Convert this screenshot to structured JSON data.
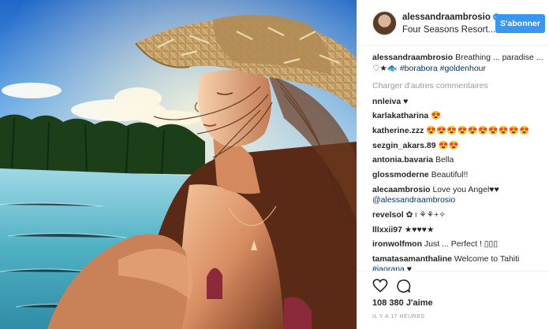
{
  "post": {
    "header": {
      "username": "alessandraambrosio",
      "location": "Four Seasons Resort...",
      "follow_label": "S'abonner"
    },
    "caption": {
      "username": "alessandraambrosio",
      "text": "Breathing ... paradise ... ♡★🐟 ",
      "tag1": "#borabora",
      "tag2": "#goldenhour"
    },
    "load_more_label": "Charger d'autres commentaires",
    "comments": [
      {
        "user": "nnleiva",
        "text": "♥"
      },
      {
        "user": "karlakatharina",
        "text": "😍"
      },
      {
        "user": "katherine.zzz",
        "text": "😍😍😍😍😍😍😍😍😍😍"
      },
      {
        "user": "sezgin_akars.89",
        "text": "😍😍"
      },
      {
        "user": "antonia.bavaria",
        "text": "Bella"
      },
      {
        "user": "glossmoderne",
        "text": "Beautiful!!"
      },
      {
        "user": "alecaambrosio",
        "text": "Love you Angel♥♥",
        "mention": "@alessandraambrosio"
      },
      {
        "user": "revelsol",
        "text": "✿♀⚘⚘+✧"
      },
      {
        "user": "lllxxii97",
        "text": "★♥♥♥★"
      },
      {
        "user": "ironwolfmon",
        "text": "Just ... Perfect ! ▯▯▯"
      },
      {
        "user": "tamatasamanthaline",
        "text": "Welcome to Tahiti ",
        "tag": "#iaorana",
        "tail": " ♥"
      }
    ],
    "likes": "108 380 J'aime",
    "timestamp": "IL Y A 17 HEURES",
    "colors": {
      "accent": "#3897f0",
      "hashtag": "#003569",
      "muted": "#999999",
      "sky": "#3a7fd0",
      "water": "#4fb0c0",
      "skin": "#d9906a"
    }
  }
}
